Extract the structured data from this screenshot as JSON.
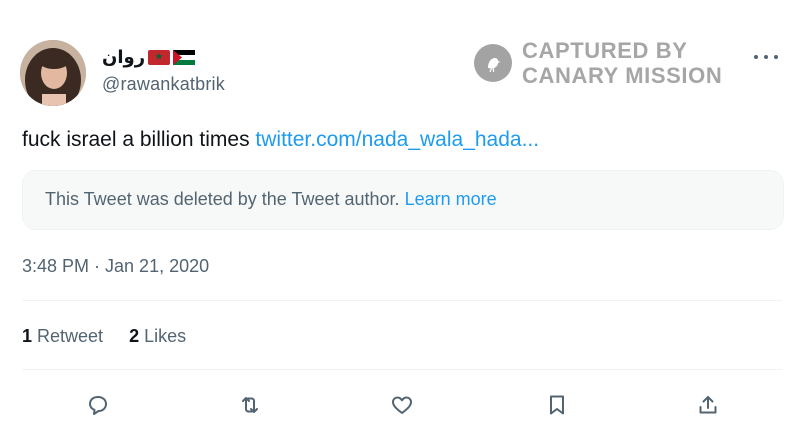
{
  "author": {
    "name": "روان",
    "handle": "@rawankatbrik",
    "flags": [
      "morocco-flag",
      "palestine-flag"
    ]
  },
  "watermark": {
    "line1": "CAPTURED BY",
    "line2": "CANARY MISSION",
    "icon": "canary-bird-icon"
  },
  "tweet": {
    "text": "fuck israel a billion times ",
    "link": "twitter.com/nada_wala_hada..."
  },
  "deleted_notice": {
    "text": "This Tweet was deleted by the Tweet author. ",
    "learn_more": "Learn more"
  },
  "timestamp": "3:48 PM · Jan 21, 2020",
  "stats": {
    "retweets_count": "1",
    "retweets_label": " Retweet",
    "likes_count": "2",
    "likes_label": " Likes"
  },
  "actions": [
    "reply-icon",
    "retweet-icon",
    "like-icon",
    "bookmark-icon",
    "share-icon"
  ],
  "colors": {
    "link": "#1d9bf0",
    "secondary_text": "#536471",
    "primary_text": "#0f1419",
    "watermark": "#a6a6a6"
  }
}
